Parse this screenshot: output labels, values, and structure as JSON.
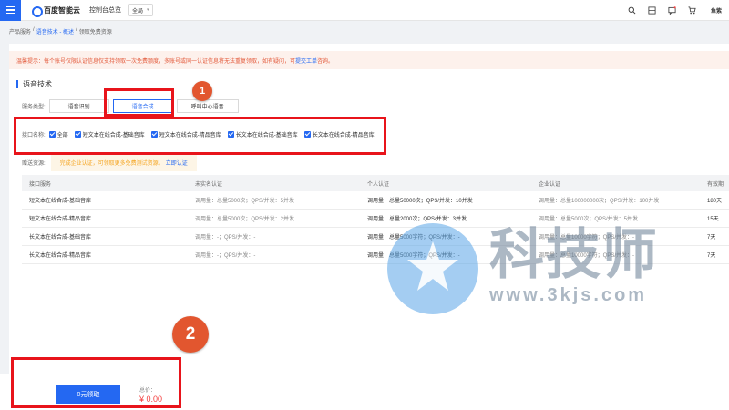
{
  "topbar": {
    "logo_text": "百度智能云",
    "console_link": "控制台总览",
    "region": "全局",
    "icons": [
      "search-icon",
      "grid-icon",
      "message-icon",
      "cart-icon"
    ],
    "user": "鱼紫"
  },
  "breadcrumb": {
    "items": [
      "产品服务",
      "/",
      "语音技术 - 概述",
      "/",
      "领取免费资源"
    ]
  },
  "notice": {
    "text": "温馨提示：每个账号仅限认证信息仅支持领取一次免费额度，多账号或同一认证信息将无法重复领取，如有疑问，可",
    "link": "提交工单",
    "suffix": "咨询。"
  },
  "section": {
    "title": "语音技术"
  },
  "service": {
    "label": "服务类型:",
    "options": [
      "语音识别",
      "语音合成",
      "呼叫中心语音"
    ],
    "selected": "语音合成"
  },
  "interfaces": {
    "label": "接口名称:",
    "items": [
      {
        "label": "全部",
        "checked": true
      },
      {
        "label": "短文本在线合成-基础音库",
        "checked": true
      },
      {
        "label": "短文本在线合成-精品音库",
        "checked": true
      },
      {
        "label": "长文本在线合成-基础音库",
        "checked": true
      },
      {
        "label": "长文本在线合成-精品音库",
        "checked": true
      }
    ]
  },
  "gift": {
    "label": "赠送资源:",
    "text": "完成企业认证，可领取更多免费测试资源。",
    "link": "立即认证"
  },
  "table": {
    "headers": [
      "接口服务",
      "未实名认证",
      "个人认证",
      "企业认证",
      "有效期"
    ],
    "rows": [
      [
        "短文本在线合成-基础音库",
        "调用量：总量5000次；QPS/并发：5并发",
        "调用量：总量50000次；QPS/并发：10并发",
        "调用量：总量100000000次；QPS/并发：100并发",
        "180天"
      ],
      [
        "短文本在线合成-精品音库",
        "调用量：总量5000次；QPS/并发：2并发",
        "调用量：总量2000次；QPS/并发：3并发",
        "调用量：总量5000次；QPS/并发：5并发",
        "15天"
      ],
      [
        "长文本在线合成-基础音库",
        "调用量：-；QPS/并发：-",
        "调用量：总量5000字符；QPS/并发：-",
        "调用量：总量10000字符；QPS/并发：-",
        "7天"
      ],
      [
        "长文本在线合成-精品音库",
        "调用量：-；QPS/并发：-",
        "调用量：总量5000字符；QPS/并发：-",
        "调用量：总量10000字符；QPS/并发：-",
        "7天"
      ]
    ]
  },
  "footer": {
    "claim_label": "0元领取",
    "total_label": "总价：",
    "total_price": "¥ 0.00"
  },
  "annotations": {
    "badge_1": "1",
    "badge_2": "2"
  },
  "watermark": {
    "text": "科技师",
    "url": "www.3kjs.com"
  },
  "colors": {
    "accent": "#2468f2",
    "annotation_red": "#e8141b",
    "badge": "#e2562f",
    "price": "#f33e3e"
  }
}
